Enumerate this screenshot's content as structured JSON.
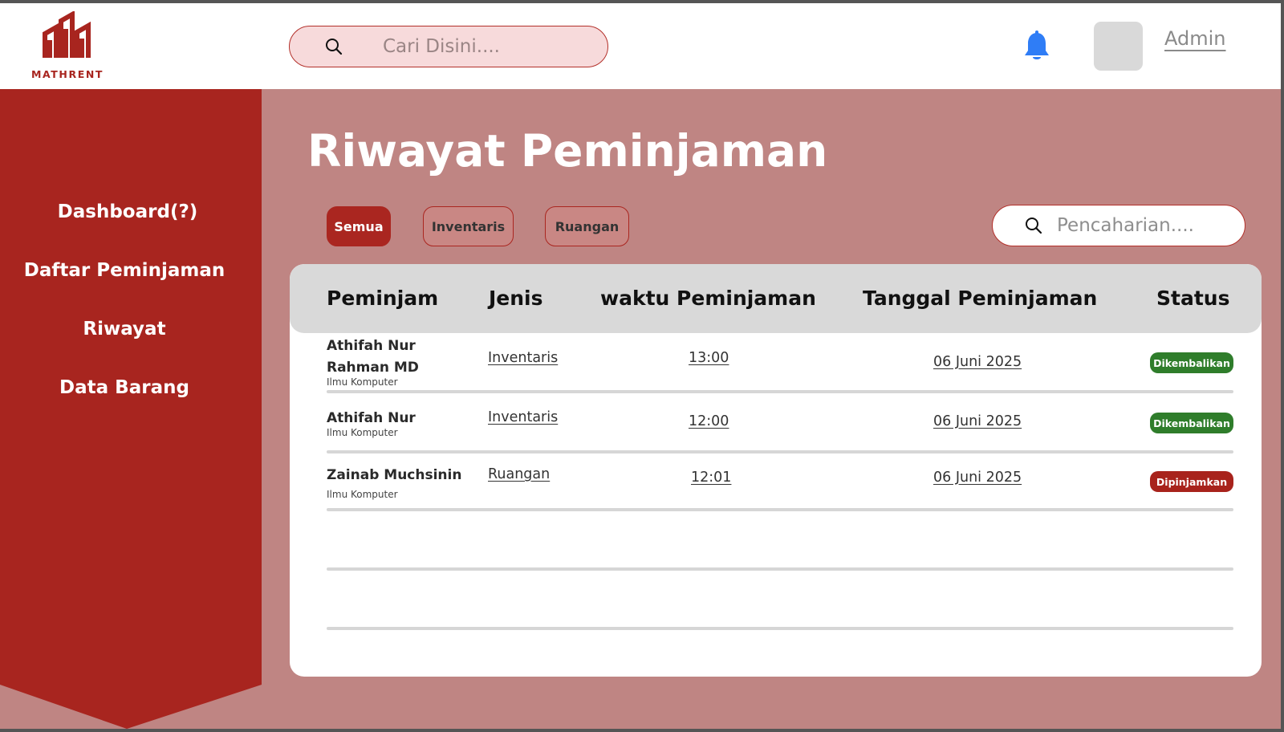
{
  "app": {
    "logo_text": "MATHRENT"
  },
  "header": {
    "search_placeholder": "Cari Disini....",
    "user_label": "Admin"
  },
  "sidebar": {
    "items": [
      {
        "label": "Dashboard(?)"
      },
      {
        "label": "Daftar Peminjaman"
      },
      {
        "label": "Riwayat"
      },
      {
        "label": "Data Barang"
      }
    ]
  },
  "main": {
    "title": "Riwayat Peminjaman",
    "filters": [
      {
        "label": "Semua",
        "active": true
      },
      {
        "label": "Inventaris",
        "active": false
      },
      {
        "label": "Ruangan",
        "active": false
      }
    ],
    "search_placeholder": "Pencaharian....",
    "table": {
      "headers": [
        "Peminjam",
        "Jenis",
        "waktu Peminjaman",
        "Tanggal Peminjaman",
        "Status"
      ],
      "rows": [
        {
          "name_line1": "Athifah Nur",
          "name_line2": "Rahman MD",
          "dept": "Ilmu Komputer",
          "jenis": "Inventaris",
          "waktu": "13:00",
          "tanggal": "06 Juni 2025",
          "status": "Dikembalikan",
          "status_color": "#2f7d2b"
        },
        {
          "name_line1": "Athifah Nur",
          "name_line2": "",
          "dept": "Ilmu Komputer",
          "jenis": "Inventaris",
          "waktu": "12:00",
          "tanggal": "06 Juni 2025",
          "status": "Dikembalikan",
          "status_color": "#2f7d2b"
        },
        {
          "name_line1": "Zainab Muchsinin",
          "name_line2": "",
          "dept": "Ilmu Komputer",
          "jenis": "Ruangan",
          "waktu": "12:01",
          "tanggal": "06 Juni 2025",
          "status": "Dipinjamkan",
          "status_color": "#a8231c"
        }
      ]
    }
  },
  "colors": {
    "brand_red": "#a8251f",
    "background": "#bf8583",
    "bell_blue": "#2f7df6"
  },
  "icons": [
    "mathrent-logo-icon",
    "search-icon",
    "bell-icon"
  ]
}
